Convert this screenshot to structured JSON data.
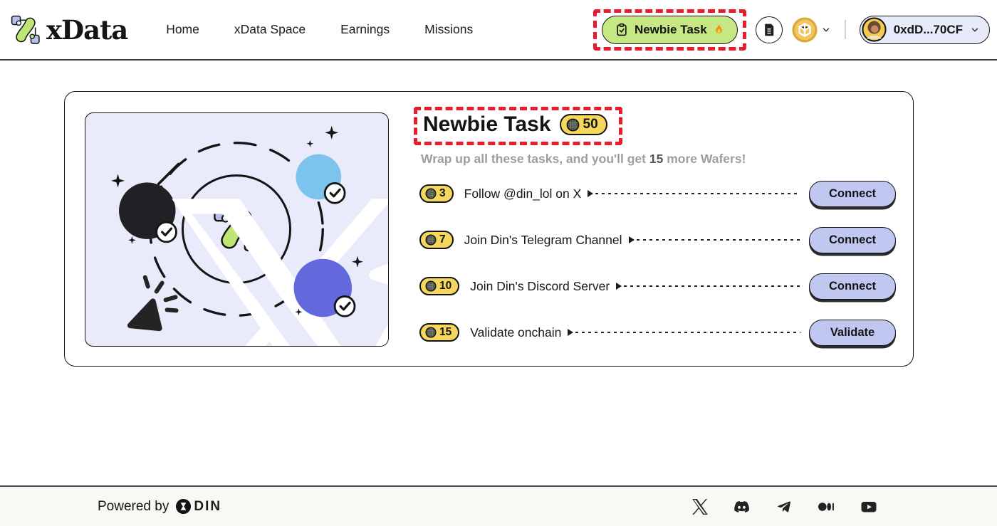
{
  "header": {
    "logo_text": "xData",
    "nav": [
      {
        "label": "Home"
      },
      {
        "label": "xData Space"
      },
      {
        "label": "Earnings"
      },
      {
        "label": "Missions"
      }
    ],
    "newbie_task_button": {
      "label": "Newbie Task"
    },
    "wallet": {
      "address": "0xdD...70CF"
    }
  },
  "card": {
    "title": "Newbie Task",
    "title_badge_points": "50",
    "subtitle_pre": "Wrap up all these tasks, and you'll get ",
    "subtitle_bold": "15",
    "subtitle_post": " more Wafers!",
    "tasks": [
      {
        "points": "3",
        "label": "Follow @din_lol on X",
        "action": "Connect"
      },
      {
        "points": "7",
        "label": "Join Din's Telegram Channel",
        "action": "Connect"
      },
      {
        "points": "10",
        "label": "Join Din's Discord Server",
        "action": "Connect"
      },
      {
        "points": "15",
        "label": "Validate onchain",
        "action": "Validate"
      }
    ]
  },
  "footer": {
    "powered_by": "Powered by",
    "brand": "DIN",
    "social_icons": [
      "x-icon",
      "discord-icon",
      "telegram-icon",
      "medium-icon",
      "youtube-icon"
    ]
  },
  "icons": {
    "header": [
      "xdata-logo-icon",
      "clipboard-check-icon",
      "fire-icon",
      "document-icon",
      "bnb-coin-icon",
      "chevron-down-icon",
      "avatar"
    ],
    "task_row": [
      "wafer-icon",
      "arrow-right-icon"
    ]
  },
  "colors": {
    "annotation_red": "#e81c2c",
    "button_green": "#c6e884",
    "badge_yellow": "#f6d75e",
    "action_lavender": "#c0c7f1",
    "illustration_bg": "#e9ebfb",
    "wallet_bg": "#e7eaf9",
    "coin_gold": "#efc75e",
    "telegram_blue": "#7cc4ee",
    "discord_purple": "#6468dd"
  }
}
